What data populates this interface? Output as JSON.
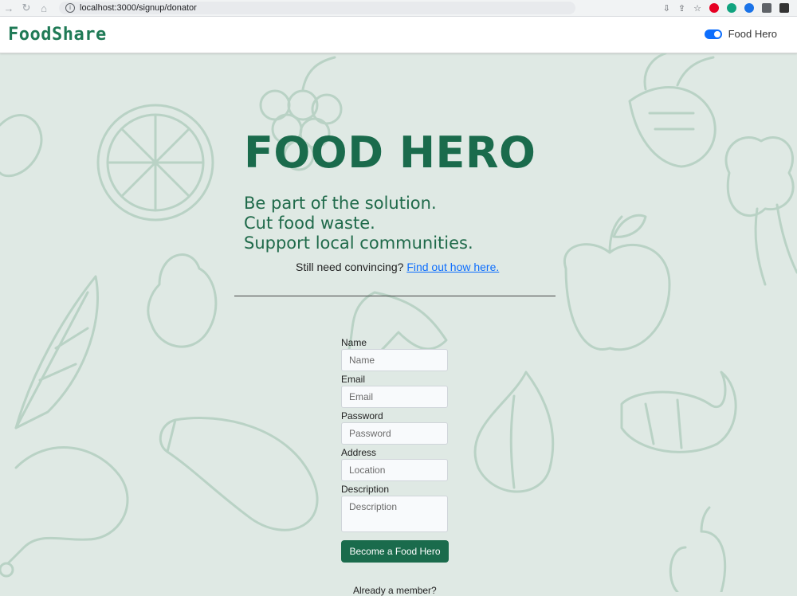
{
  "browser": {
    "url": "localhost:3000/signup/donator"
  },
  "navbar": {
    "brand": "FoodShare",
    "role_label": "Food Hero"
  },
  "hero": {
    "title": "FOOD HERO",
    "tagline": [
      "Be part of the solution.",
      "Cut food waste.",
      "Support local communities."
    ],
    "convince_text": "Still need convincing?",
    "convince_link": "Find out how here."
  },
  "form": {
    "name_label": "Name",
    "name_placeholder": "Name",
    "email_label": "Email",
    "email_placeholder": "Email",
    "password_label": "Password",
    "password_placeholder": "Password",
    "address_label": "Address",
    "address_placeholder": "Location",
    "description_label": "Description",
    "description_placeholder": "Description",
    "submit_label": "Become a Food Hero",
    "already_member": "Already a member?"
  },
  "colors": {
    "brand_green": "#1a6b4c",
    "background": "#dfe9e4",
    "link": "#0d6efd"
  }
}
